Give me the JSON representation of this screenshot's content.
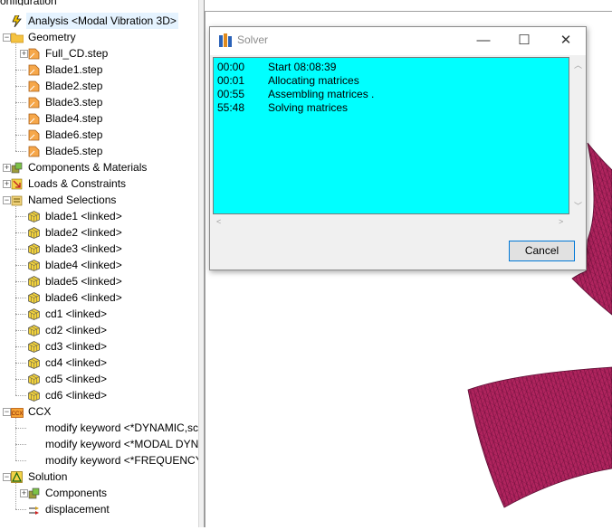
{
  "tree": {
    "config_tab": "onfiguration",
    "items": [
      {
        "label": "Analysis <Modal Vibration 3D>",
        "icon": "analysis-lightning-icon"
      },
      {
        "label": "Geometry",
        "icon": "folder-icon"
      },
      {
        "label": "Full_CD.step",
        "icon": "part-icon"
      },
      {
        "label": "Blade1.step",
        "icon": "part-icon"
      },
      {
        "label": "Blade2.step",
        "icon": "part-icon"
      },
      {
        "label": "Blade3.step",
        "icon": "part-icon"
      },
      {
        "label": "Blade4.step",
        "icon": "part-icon"
      },
      {
        "label": "Blade6.step",
        "icon": "part-icon"
      },
      {
        "label": "Blade5.step",
        "icon": "part-icon"
      },
      {
        "label": "Components & Materials",
        "icon": "components-icon"
      },
      {
        "label": "Loads & Constraints",
        "icon": "loads-icon"
      },
      {
        "label": "Named Selections",
        "icon": "named-selection-icon"
      },
      {
        "label": "blade1 <linked>",
        "icon": "cube-icon"
      },
      {
        "label": "blade2 <linked>",
        "icon": "cube-icon"
      },
      {
        "label": "blade3 <linked>",
        "icon": "cube-icon"
      },
      {
        "label": "blade4 <linked>",
        "icon": "cube-icon"
      },
      {
        "label": "blade5 <linked>",
        "icon": "cube-icon"
      },
      {
        "label": "blade6 <linked>",
        "icon": "cube-icon"
      },
      {
        "label": "cd1 <linked>",
        "icon": "cube-icon"
      },
      {
        "label": "cd2 <linked>",
        "icon": "cube-icon"
      },
      {
        "label": "cd3 <linked>",
        "icon": "cube-icon"
      },
      {
        "label": "cd4 <linked>",
        "icon": "cube-icon"
      },
      {
        "label": "cd5 <linked>",
        "icon": "cube-icon"
      },
      {
        "label": "cd6 <linked>",
        "icon": "cube-icon"
      },
      {
        "label": "CCX",
        "icon": "ccx-icon",
        "icon_text": "CCX"
      },
      {
        "label": "modify keyword <*DYNAMIC,sc",
        "icon": "none"
      },
      {
        "label": "modify keyword <*MODAL DYN",
        "icon": "none"
      },
      {
        "label": "modify keyword <*FREQUENCY,",
        "icon": "none"
      },
      {
        "label": "Solution",
        "icon": "solution-icon"
      },
      {
        "label": "Components",
        "icon": "components-icon"
      },
      {
        "label": "displacement",
        "icon": "displacement-icon"
      }
    ]
  },
  "dialog": {
    "title": "Solver",
    "minimize": "—",
    "maximize": "☐",
    "close": "✕",
    "log": [
      {
        "time": "00:00",
        "msg": "Start 08:08:39"
      },
      {
        "time": "00:01",
        "msg": "Allocating matrices"
      },
      {
        "time": "00:55",
        "msg": "Assembling matrices ."
      },
      {
        "time": "55:48",
        "msg": "Solving matrices"
      }
    ],
    "cancel_label": "Cancel"
  },
  "colors": {
    "log_background": "#00ffff",
    "mesh_fill": "#b0245e",
    "mesh_line": "#6a0f3a",
    "selection": "#e5f3ff"
  }
}
